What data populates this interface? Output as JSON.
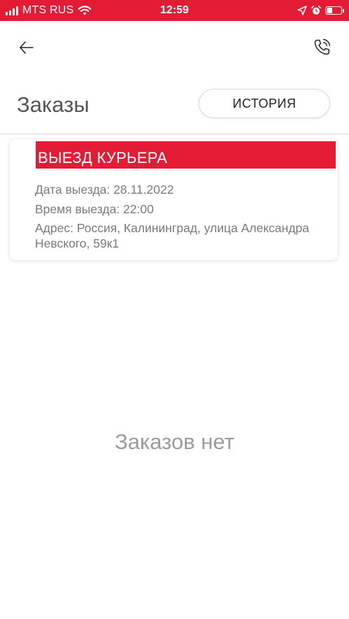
{
  "status_bar": {
    "carrier": "MTS RUS",
    "time": "12:59",
    "battery_level": 0.35,
    "icons": [
      "signal-icon",
      "wifi-icon",
      "location-arrow-icon",
      "alarm-clock-icon",
      "battery-icon"
    ]
  },
  "header": {
    "back_icon": "arrow-left-icon",
    "phone_icon": "phone-call-icon"
  },
  "title": "Заказы",
  "history_button": "ИСТОРИЯ",
  "order": {
    "type": "ВЫЕЗД КУРЬЕРА",
    "date_label": "Дата выезда: 28.11.2022",
    "time_label": "Время выезда: 22:00",
    "address_label": "Адрес: Россия, Калининград, улица Александра Невского, 59к1"
  },
  "empty_message": "Заказов нет",
  "colors": {
    "accent": "#e41b35",
    "title_text": "#555555",
    "secondary_text": "#7a7a7a",
    "empty_text": "#9b9b9b"
  }
}
